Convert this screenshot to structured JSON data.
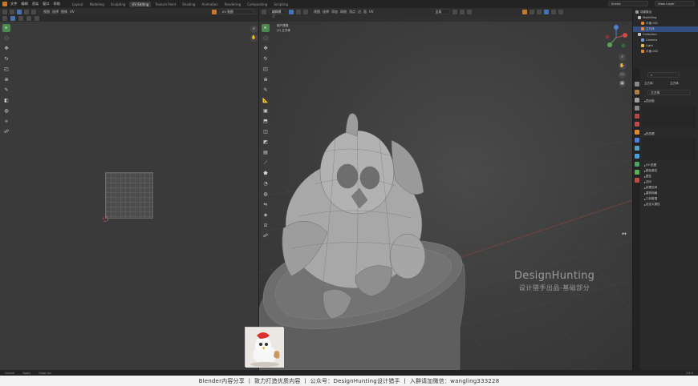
{
  "menu": {
    "items": [
      "文件",
      "编辑",
      "渲染",
      "窗口",
      "帮助"
    ],
    "workspace_tabs": [
      "Layout",
      "Modeling",
      "Sculpting",
      "UV Editing",
      "Texture Paint",
      "Shading",
      "Animation",
      "Rendering",
      "Compositing",
      "Scripting"
    ],
    "active_tab": "UV Editing",
    "scene_label": "Scene",
    "view_layer_label": "View Layer"
  },
  "uv_editor": {
    "header_labels": [
      "视图",
      "选择",
      "图像",
      "UV"
    ],
    "image_field": "UV 贴图"
  },
  "viewport": {
    "header_labels": [
      "编辑模式",
      "视图",
      "选择",
      "添加",
      "网格",
      "顶点",
      "边",
      "面",
      "UV"
    ],
    "transform_label": "全局",
    "overlay_line1": "用户透视",
    "overlay_line2": "(2) 立方体"
  },
  "watermark": {
    "title": "DesignHunting",
    "subtitle": "设计猎手出品-基础部分"
  },
  "outliner": {
    "rows": [
      {
        "label": "场景集合",
        "color": "#9a9a9a",
        "indent": 0
      },
      {
        "label": "Modelling",
        "color": "#bfbfbf",
        "indent": 1
      },
      {
        "label": "平面.001",
        "color": "#e08a2c",
        "indent": 2
      },
      {
        "label": "立方体",
        "color": "#e08a2c",
        "indent": 2
      },
      {
        "label": "Collection",
        "color": "#bfbfbf",
        "indent": 1
      },
      {
        "label": "Camera",
        "color": "#6d9ad8",
        "indent": 2
      },
      {
        "label": "Light",
        "color": "#e0c050",
        "indent": 2
      },
      {
        "label": "平面.002",
        "color": "#e08a2c",
        "indent": 2
      }
    ]
  },
  "properties": {
    "object_tab": "立方体",
    "mesh_tab": "立方体",
    "data_name": "立方体",
    "section_vertex_groups": "顶点组",
    "section_shape_keys": "形态键",
    "sections": [
      "UV 贴图",
      "颜色属性",
      "属性",
      "法向",
      "纹理空间",
      "重构网格",
      "几何数据",
      "自定义属性"
    ]
  },
  "status": {
    "items": [
      "Cancel",
      "Apply",
      "Snap Inv"
    ],
    "version": "3.6.5"
  },
  "caption": {
    "text": "Blender内容分享  丨  致力打造优质内容  丨  公众号：DesignHunting设计猎手  丨  入群请加微信：wangling333228"
  }
}
